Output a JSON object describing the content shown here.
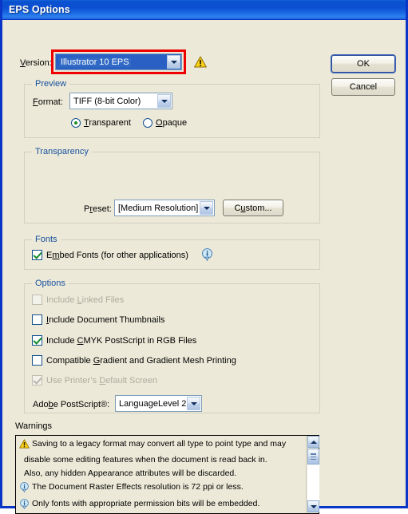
{
  "window": {
    "title": "EPS Options",
    "accent_title_bar": "#0a52d0",
    "dialog_background": "#ece9d8",
    "group_title_color": "#16519e",
    "highlight_box_color": "#ee0000"
  },
  "version_row": {
    "label": "Version:",
    "label_accel": "V",
    "value": "Illustrator 10 EPS",
    "warning_icon": "warning-triangle-icon"
  },
  "buttons": {
    "ok": "OK",
    "cancel": "Cancel",
    "custom": "Custom..."
  },
  "preview": {
    "group_title": "Preview",
    "format_label": "Format:",
    "format_accel": "F",
    "format_value": "TIFF (8-bit Color)",
    "radio_transparent": "Transparent",
    "radio_transparent_accel": "T",
    "radio_opaque": "Opaque",
    "radio_opaque_accel": "O",
    "selected_radio": "Transparent"
  },
  "transparency": {
    "group_title": "Transparency",
    "preset_label": "Preset:",
    "preset_accel": "r",
    "preset_value": "[Medium Resolution]",
    "custom_button": "Custom...",
    "custom_accel": "u"
  },
  "fonts": {
    "group_title": "Fonts",
    "embed_label": "Embed Fonts (for other applications)",
    "embed_accel": "m",
    "embed_checked": true,
    "info_icon": "info-bubble-icon"
  },
  "options": {
    "group_title": "Options",
    "items": [
      {
        "label": "Include Linked Files",
        "accel": "L",
        "checked": false,
        "disabled": true
      },
      {
        "label": "Include Document Thumbnails",
        "accel": "I",
        "checked": false,
        "disabled": false
      },
      {
        "label": "Include CMYK PostScript in RGB Files",
        "accel": "C",
        "checked": true,
        "disabled": false
      },
      {
        "label": "Compatible Gradient and Gradient Mesh Printing",
        "accel": "G",
        "checked": false,
        "disabled": false
      },
      {
        "label": "Use Printer's Default Screen",
        "accel": "D",
        "checked": true,
        "disabled": true
      }
    ],
    "postscript_label": "Adobe PostScript®:",
    "postscript_accel": "b",
    "postscript_value": "LanguageLevel 2"
  },
  "warnings": {
    "label": "Warnings",
    "lines": [
      {
        "icon": "warning-triangle-icon",
        "text": "Saving to a legacy format may convert all type to point type and may"
      },
      {
        "icon": "none",
        "text": "disable some editing features when the document is read back in."
      },
      {
        "icon": "none",
        "text": "Also, any hidden Appearance attributes will be discarded."
      },
      {
        "icon": "info-bubble-icon",
        "text": "The Document Raster Effects resolution is 72 ppi or less."
      },
      {
        "icon": "info-bubble-icon",
        "text": "Only fonts with appropriate permission bits will be embedded."
      }
    ],
    "scrollbar": {
      "up_arrow": "scroll-up-icon",
      "down_arrow": "scroll-down-icon",
      "thumb": "scroll-thumb"
    }
  }
}
